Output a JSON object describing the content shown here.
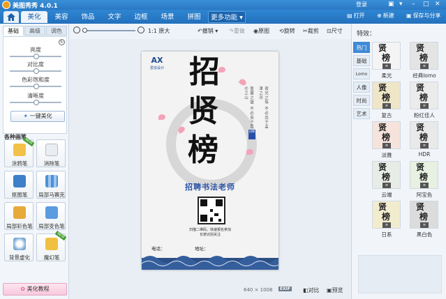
{
  "app": {
    "title": "美图秀秀 4.0.1",
    "login": "登录"
  },
  "nav": {
    "tabs": [
      "美化",
      "美容",
      "饰品",
      "文字",
      "边框",
      "场景",
      "拼图"
    ],
    "more": "更多功能",
    "open": "打开",
    "new": "新建",
    "save": "保存与分享"
  },
  "left": {
    "subtabs": [
      "基础",
      "高级",
      "调色"
    ],
    "sliders": [
      "亮度",
      "对比度",
      "色彩饱和度",
      "清晰度"
    ],
    "onekey": "一键美化",
    "brush_title": "各种画笔",
    "tools": [
      "涂鸦笔",
      "消除笔",
      "抠图笔",
      "局部马赛克",
      "局部彩色笔",
      "局部变色笔",
      "背景虚化",
      "魔幻笔"
    ],
    "tutorial": "美化教程"
  },
  "toolbar": {
    "original_size": "1:1 原大",
    "undo": "撤销",
    "redo": "重做",
    "original": "原图",
    "rotate": "旋转",
    "crop": "裁剪",
    "size": "尺寸"
  },
  "poster": {
    "logo": "AX",
    "logo_sub": "爱炫设计",
    "chars": [
      "招",
      "贤",
      "榜"
    ],
    "vtext_right": "夜光之珠\n不必出于孟津之河",
    "vtext_left": "盈握之璧\n不必采于昆仑之山",
    "seal": "招聘",
    "subtitle": "招聘书法老师",
    "qr_caption_1": "扫描二维码，快速报名参加",
    "qr_caption_2": "长按识别关注",
    "phone_label": "电话：",
    "address_label": "地址："
  },
  "status": {
    "dimensions": "640 × 1008",
    "exif": "EXIF",
    "compare": "对比",
    "preview": "预览"
  },
  "effects": {
    "title": "特效：",
    "categories": [
      "热门",
      "基础",
      "Lomo",
      "人像",
      "时尚",
      "艺术"
    ],
    "items": [
      "柔光",
      "经典lomo",
      "复古",
      "粉红佳人",
      "淡雅",
      "HDR",
      "云端",
      "阿宝色",
      "日系",
      "黑白色"
    ]
  },
  "colors": {
    "nav_blue": "#2a78c4",
    "active_cat": "#3f8ad6",
    "poster_title_blue": "#2a55a8",
    "tutorial_pink": "#f8c8dc"
  }
}
